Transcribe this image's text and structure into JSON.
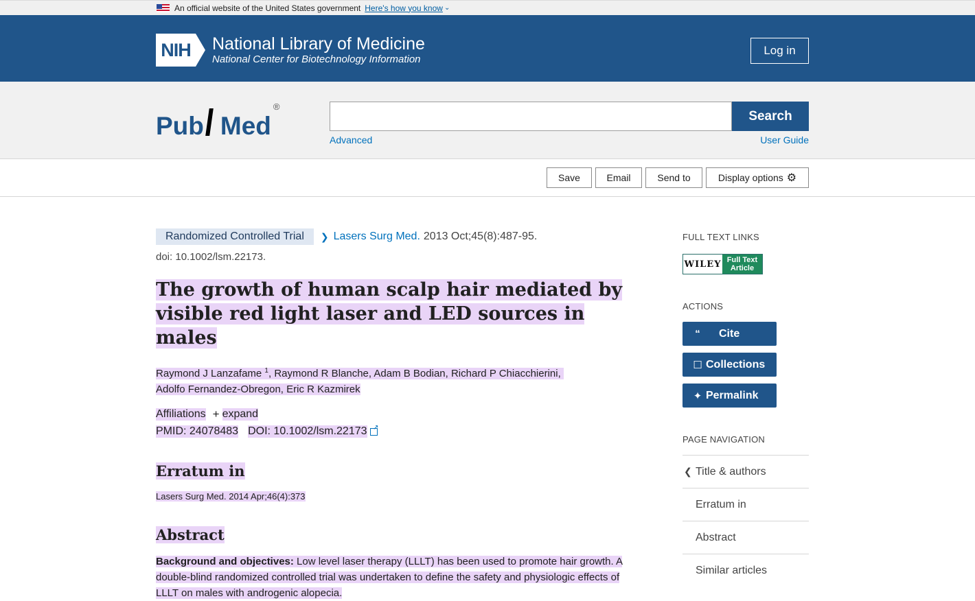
{
  "gov_banner": {
    "text": "An official website of the United States government",
    "link": "Here's how you know"
  },
  "header": {
    "nih_box": "NIH",
    "title": "National Library of Medicine",
    "subtitle": "National Center for Biotechnology Information",
    "login": "Log in"
  },
  "search": {
    "logo_pub": "Pub",
    "logo_med": "Med",
    "logo_reg": "®",
    "value": "",
    "button": "Search",
    "advanced": "Advanced",
    "user_guide": "User Guide"
  },
  "toolbar": {
    "save": "Save",
    "email": "Email",
    "send_to": "Send to",
    "display_options": "Display options"
  },
  "article": {
    "pub_type": "Randomized Controlled Trial",
    "journal": "Lasers Surg Med.",
    "citation": "2013 Oct;45(8):487-95.",
    "doi_line": "doi: 10.1002/lsm.22173.",
    "title": "The growth of human scalp hair mediated by visible red light laser and LED sources in males",
    "author_first": "Raymond J Lanzafame",
    "author_first_sup": "1",
    "authors_rest": ", Raymond R Blanche, Adam B Bodian, Richard P Chiacchierini,",
    "authors_line2": "Adolfo Fernandez-Obregon, Eric R Kazmirek",
    "affiliations": "Affiliations",
    "expand": "expand",
    "pmid": "PMID: 24078483",
    "doi": "DOI: 10.1002/lsm.22173",
    "erratum_heading": "Erratum in",
    "erratum_citation": "Lasers Surg Med. 2014 Apr;46(4):373",
    "abstract_heading": "Abstract",
    "abstract_label": "Background and objectives:",
    "abstract_text": " Low level laser therapy (LLLT) has been used to promote hair growth. A double-blind randomized controlled trial was undertaken to define the safety and physiologic effects of LLLT on males with androgenic alopecia."
  },
  "sidebar": {
    "full_text_heading": "FULL TEXT LINKS",
    "wiley_left": "WILEY",
    "wiley_right_1": "Full Text",
    "wiley_right_2": "Article",
    "actions_heading": "ACTIONS",
    "cite": "Cite",
    "collections": "Collections",
    "permalink": "Permalink",
    "nav_heading": "PAGE NAVIGATION",
    "nav_items": [
      "Title & authors",
      "Erratum in",
      "Abstract",
      "Similar articles"
    ]
  },
  "colors": {
    "nih_blue": "#20558a",
    "link_blue": "#0071bc",
    "highlight": "#e9d4f7",
    "wiley_green": "#1f8a5c"
  }
}
